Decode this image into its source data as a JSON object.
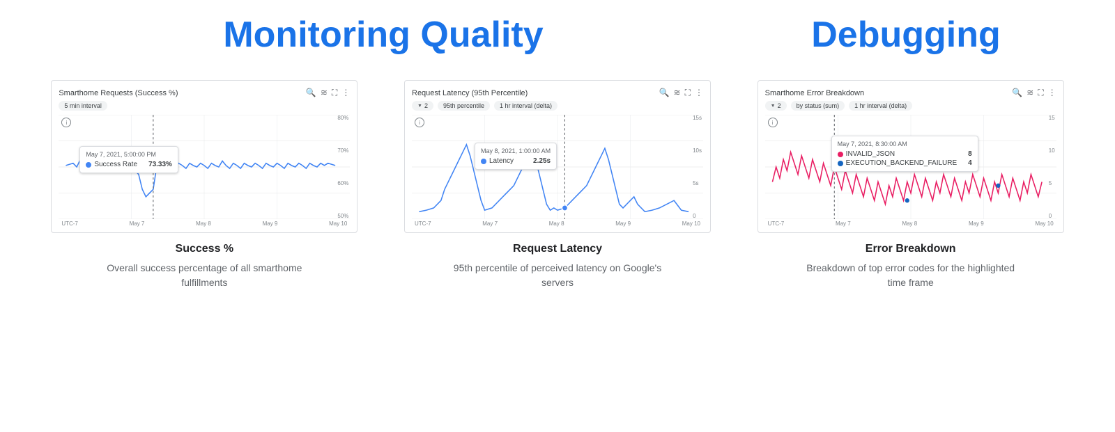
{
  "sections": {
    "monitoring": {
      "title": "Monitoring Quality",
      "charts": [
        {
          "id": "success-rate",
          "title": "Smarthome Requests (Success %)",
          "filters": [
            "5 min interval"
          ],
          "y_labels": [
            "80%",
            "70%",
            "60%",
            "50%"
          ],
          "x_labels": [
            "UTC-7",
            "May 7",
            "May 8",
            "May 9",
            "May 10"
          ],
          "tooltip": {
            "date": "May 7, 2021, 5:00:00 PM",
            "rows": [
              {
                "color": "#4285f4",
                "label": "Success Rate",
                "value": "73.33%"
              }
            ]
          },
          "label": "Success %",
          "description": "Overall success percentage of all smarthome fulfillments",
          "line_color": "#4285f4"
        },
        {
          "id": "request-latency",
          "title": "Request Latency (95th Percentile)",
          "filters": [
            "2",
            "95th percentile",
            "1 hr interval (delta)"
          ],
          "y_labels": [
            "15s",
            "10s",
            "5s",
            "0"
          ],
          "x_labels": [
            "UTC-7",
            "May 7",
            "May 8",
            "May 9",
            "May 10"
          ],
          "tooltip": {
            "date": "May 8, 2021, 1:00:00 AM",
            "rows": [
              {
                "color": "#4285f4",
                "label": "Latency",
                "value": "2.25s"
              }
            ]
          },
          "label": "Request Latency",
          "description": "95th percentile of perceived latency on Google's servers",
          "line_color": "#4285f4"
        },
        {
          "id": "error-breakdown",
          "title": "Smarthome Error Breakdown",
          "filters": [
            "2",
            "by status (sum)",
            "1 hr interval (delta)"
          ],
          "y_labels": [
            "15",
            "10",
            "5",
            "0"
          ],
          "x_labels": [
            "UTC-7",
            "May 7",
            "May 8",
            "May 9",
            "May 10"
          ],
          "tooltip": {
            "date": "May 7, 2021, 8:30:00 AM",
            "rows": [
              {
                "color": "#e91e63",
                "label": "INVALID_JSON",
                "value": "8"
              },
              {
                "color": "#1565c0",
                "label": "EXECUTION_BACKEND_FAILURE",
                "value": "4"
              }
            ]
          },
          "label": "Error Breakdown",
          "description": "Breakdown of top error codes for the highlighted time frame",
          "line_color": "#e91e63"
        }
      ]
    },
    "debugging": {
      "title": "Debugging"
    }
  }
}
